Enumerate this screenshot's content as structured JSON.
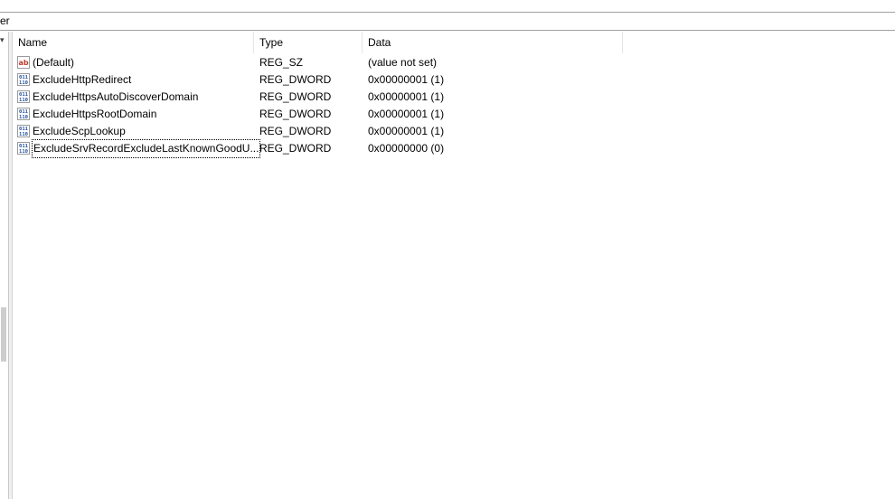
{
  "address_bar": {
    "text": "er"
  },
  "columns": {
    "name": "Name",
    "type": "Type",
    "data": "Data"
  },
  "values": [
    {
      "icon": "reg-sz-icon",
      "name": "(Default)",
      "type": "REG_SZ",
      "data": "(value not set)"
    },
    {
      "icon": "reg-dword-icon",
      "name": "ExcludeHttpRedirect",
      "type": "REG_DWORD",
      "data": "0x00000001 (1)"
    },
    {
      "icon": "reg-dword-icon",
      "name": "ExcludeHttpsAutoDiscoverDomain",
      "type": "REG_DWORD",
      "data": "0x00000001 (1)"
    },
    {
      "icon": "reg-dword-icon",
      "name": "ExcludeHttpsRootDomain",
      "type": "REG_DWORD",
      "data": "0x00000001 (1)"
    },
    {
      "icon": "reg-dword-icon",
      "name": "ExcludeScpLookup",
      "type": "REG_DWORD",
      "data": "0x00000001 (1)"
    },
    {
      "icon": "reg-dword-icon",
      "name": "ExcludeSrvRecordExcludeLastKnownGoodU...",
      "type": "REG_DWORD",
      "data": "0x00000000 (0)"
    }
  ],
  "colors": {
    "sz_icon": "#c0392b",
    "dword_icon": "#1f4e9c"
  }
}
